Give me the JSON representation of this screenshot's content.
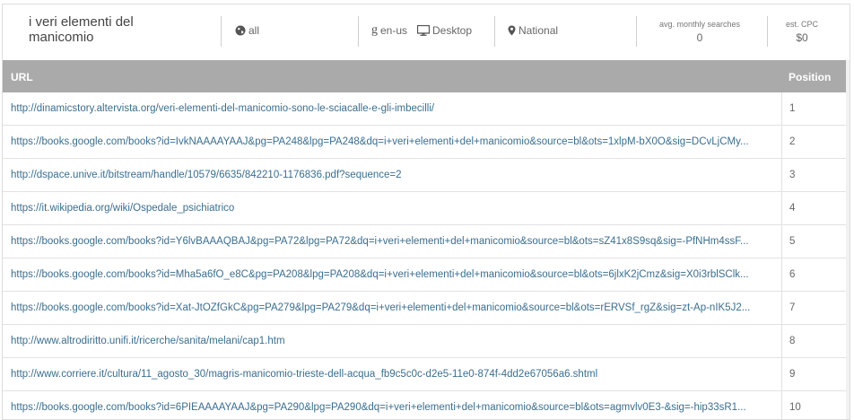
{
  "header": {
    "keyword": "i veri elementi del manicomio",
    "scope": "all",
    "language": "en-us",
    "device": "Desktop",
    "location": "National",
    "avg_monthly_searches_label": "avg. monthly searches",
    "avg_monthly_searches_value": "0",
    "est_cpc_label": "est. CPC",
    "est_cpc_value": "$0"
  },
  "table": {
    "col_url": "URL",
    "col_position": "Position",
    "rows": [
      {
        "url": "http://dinamicstory.altervista.org/veri-elementi-del-manicomio-sono-le-sciacalle-e-gli-imbecilli/",
        "position": "1"
      },
      {
        "url": "https://books.google.com/books?id=IvkNAAAAYAAJ&pg=PA248&lpg=PA248&dq=i+veri+elementi+del+manicomio&source=bl&ots=1xlpM-bX0O&sig=DCvLjCMy...",
        "position": "2"
      },
      {
        "url": "http://dspace.unive.it/bitstream/handle/10579/6635/842210-1176836.pdf?sequence=2",
        "position": "3"
      },
      {
        "url": "https://it.wikipedia.org/wiki/Ospedale_psichiatrico",
        "position": "4"
      },
      {
        "url": "https://books.google.com/books?id=Y6lvBAAAQBAJ&pg=PA72&lpg=PA72&dq=i+veri+elementi+del+manicomio&source=bl&ots=sZ41x8S9sq&sig=-PfNHm4ssF...",
        "position": "5"
      },
      {
        "url": "https://books.google.com/books?id=Mha5a6fO_e8C&pg=PA208&lpg=PA208&dq=i+veri+elementi+del+manicomio&source=bl&ots=6jlxK2jCmz&sig=X0i3rblSClk...",
        "position": "6"
      },
      {
        "url": "https://books.google.com/books?id=Xat-JtOZfGkC&pg=PA279&lpg=PA279&dq=i+veri+elementi+del+manicomio&source=bl&ots=rERVSf_rgZ&sig=zt-Ap-nIK5J2...",
        "position": "7"
      },
      {
        "url": "http://www.altrodiritto.unifi.it/ricerche/sanita/melani/cap1.htm",
        "position": "8"
      },
      {
        "url": "http://www.corriere.it/cultura/11_agosto_30/magris-manicomio-trieste-dell-acqua_fb9c5c0c-d2e5-11e0-874f-4dd2e67056a6.shtml",
        "position": "9"
      },
      {
        "url": "https://books.google.com/books?id=6PIEAAAAYAAJ&pg=PA290&lpg=PA290&dq=i+veri+elementi+del+manicomio&source=bl&ots=agmvlv0E3-&sig=-hip33sR1...",
        "position": "10"
      }
    ]
  },
  "icons": {
    "scope": "globe-icon",
    "language": "google-g-icon",
    "device": "monitor-icon",
    "location": "map-pin-icon"
  },
  "colors": {
    "table_header_bg": "#aaaaaa",
    "link": "#3b6e8f"
  }
}
